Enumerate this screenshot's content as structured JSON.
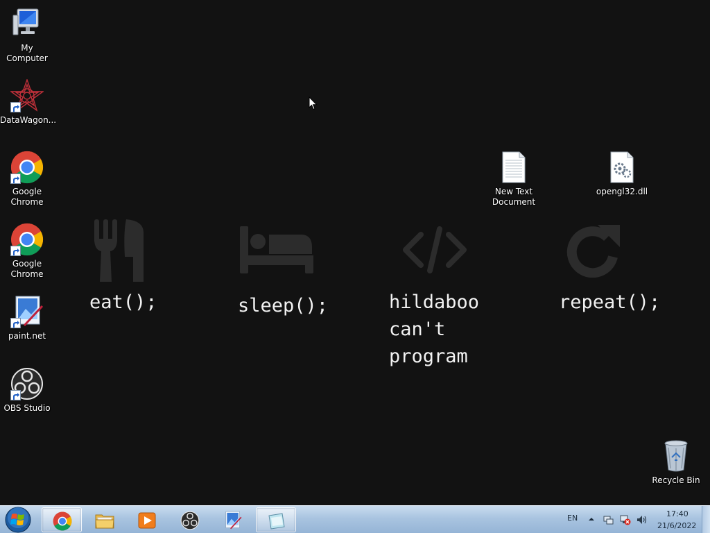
{
  "desktop": {
    "icons": [
      {
        "label": "My Computer"
      },
      {
        "label": "DataWagon..."
      },
      {
        "label": "Google Chrome"
      },
      {
        "label": "Google Chrome"
      },
      {
        "label": "paint.net"
      },
      {
        "label": "OBS Studio"
      },
      {
        "label": "New Text Document"
      },
      {
        "label": "opengl32.dll"
      },
      {
        "label": "Recycle Bin"
      }
    ]
  },
  "wallpaper": {
    "items": [
      {
        "text": "eat();",
        "icon": "fork-knife-icon"
      },
      {
        "text": "sleep();",
        "icon": "bed-icon"
      },
      {
        "text": "hildaboo\ncan't\nprogram",
        "icon": "code-icon"
      },
      {
        "text": "repeat();",
        "icon": "repeat-icon"
      }
    ],
    "icon_color": "#2c2c2c"
  },
  "taskbar": {
    "buttons": [
      {
        "name": "start-button",
        "icon": "windows-logo-icon"
      },
      {
        "name": "chrome",
        "icon": "chrome-icon",
        "active": true
      },
      {
        "name": "explorer",
        "icon": "folder-icon"
      },
      {
        "name": "media-player",
        "icon": "media-player-icon"
      },
      {
        "name": "obs",
        "icon": "obs-icon"
      },
      {
        "name": "paint-net",
        "icon": "paint-net-icon"
      },
      {
        "name": "app",
        "icon": "window-icon",
        "active": true
      }
    ],
    "tray": {
      "language": "EN",
      "time": "17:40",
      "date": "21/6/2022"
    }
  }
}
